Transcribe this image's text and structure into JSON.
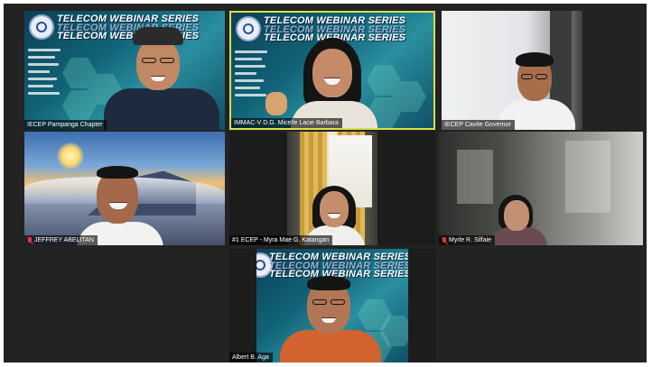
{
  "banner": {
    "title": "TELECOM WEBINAR SERIES"
  },
  "participants": [
    {
      "name": "IECEP Pampanga Chapter",
      "muted": false,
      "active": false
    },
    {
      "name": "IMMAC-V D.G. Micelle Lacie Barbara",
      "muted": false,
      "active": true
    },
    {
      "name": "IECEP Cavite Governor",
      "muted": false,
      "active": false
    },
    {
      "name": "JEFFREY ABELITAN",
      "muted": true,
      "active": false
    },
    {
      "name": "#1 ECEP - Myra Mae G. Katangan",
      "muted": false,
      "active": false
    },
    {
      "name": "Myrle R. Silfaie",
      "muted": true,
      "active": false
    },
    {
      "name": "Albert B. Aga",
      "muted": false,
      "active": false
    }
  ],
  "colors": {
    "stage": "#232323",
    "active_border": "#d8e04a",
    "muted_mic": "#e33333"
  },
  "icons": {
    "muted": "mic-muted-icon",
    "logo": "organization-logo-icon"
  }
}
